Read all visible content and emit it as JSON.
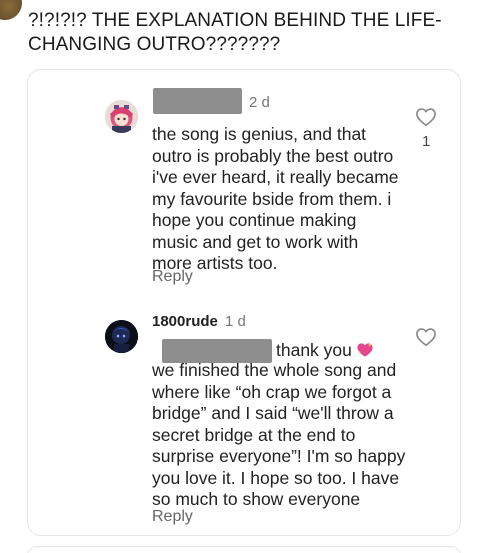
{
  "post": {
    "title": "?!?!?!? THE EXPLANATION BEHIND THE LIFE-CHANGING OUTRO???????"
  },
  "comments": [
    {
      "time": "2 d",
      "text": "the song is genius, and that outro is probably the best outro i've ever heard, it really became my favourite bside from them. i hope you continue making music and get to work with more artists too.",
      "reply_label": "Reply",
      "like_count": "1",
      "icons": {
        "like": "heart-outline-icon",
        "avatar": "avatar-anime-character"
      }
    },
    {
      "username": "1800rude",
      "time": "1 d",
      "text_first": "thank you",
      "text_rest": "we finished the whole song and where like “oh crap we forgot a bridge” and I said “we'll throw a secret bridge at the end to surprise everyone”! I'm so happy you love it. I hope so too. I have so much to show everyone",
      "reply_label": "Reply",
      "icons": {
        "like": "heart-outline-icon",
        "emoji": "sparkling-heart-emoji",
        "avatar": "avatar-dark"
      }
    }
  ],
  "colors": {
    "redaction": "#8e8e8e",
    "text": "#222222",
    "secondary_text": "#777777",
    "card_border": "#e6e6e6"
  }
}
